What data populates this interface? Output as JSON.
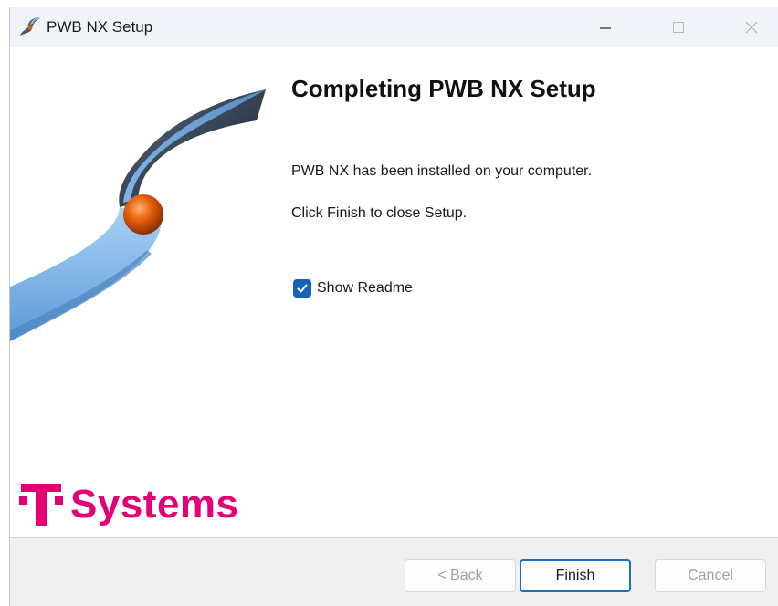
{
  "window": {
    "title": "PWB NX Setup",
    "controls": {
      "minimize": "minimize-icon",
      "maximize": "maximize-icon",
      "close": "close-icon"
    }
  },
  "main": {
    "heading": "Completing PWB NX Setup",
    "line1": "PWB NX has been installed on your computer.",
    "line2": "Click Finish to close Setup.",
    "show_readme": {
      "label": "Show Readme",
      "checked": true
    }
  },
  "brand": {
    "name": "T Systems",
    "text": "Systems",
    "color": "#e20074"
  },
  "footer": {
    "back_label": "< Back",
    "back_enabled": false,
    "finish_label": "Finish",
    "cancel_label": "Cancel",
    "cancel_enabled": false
  },
  "colors": {
    "accent": "#1463b4",
    "brand_magenta": "#e20074"
  }
}
